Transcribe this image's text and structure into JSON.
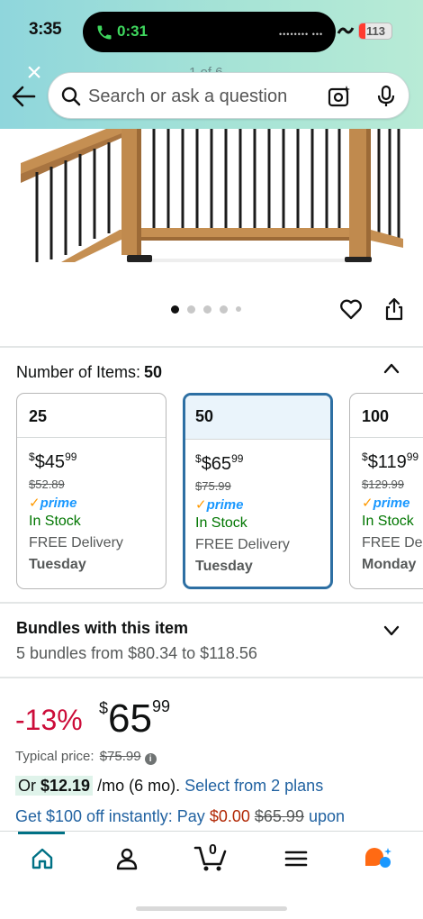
{
  "status_bar": {
    "time": "3:35",
    "call_time": "0:31",
    "battery": "113"
  },
  "header": {
    "page_counter": "1 of 6",
    "search_placeholder": "Search or ask a question"
  },
  "carousel": {
    "dots": 5,
    "active_index": 0
  },
  "items": {
    "label": "Number of Items:",
    "selected_value": "50",
    "options": [
      {
        "qty": "25",
        "price_whole": "$45",
        "price_cents": "99",
        "list_price": "$52.89",
        "prime": "prime",
        "stock": "In Stock",
        "delivery": "FREE Delivery",
        "day": "Tuesday"
      },
      {
        "qty": "50",
        "price_whole": "$65",
        "price_cents": "99",
        "list_price": "$75.99",
        "prime": "prime",
        "stock": "In Stock",
        "delivery": "FREE Delivery",
        "day": "Tuesday"
      },
      {
        "qty": "100",
        "price_whole": "$119",
        "price_cents": "99",
        "list_price": "$129.99",
        "prime": "prime",
        "stock": "In Stock",
        "delivery": "FREE Delivery",
        "day": "Monday"
      }
    ]
  },
  "bundles": {
    "title": "Bundles with this item",
    "subtitle": "5 bundles from $80.34 to $118.56"
  },
  "price": {
    "discount": "-13%",
    "currency": "$",
    "whole": "65",
    "cents": "99",
    "typical_label": "Typical price:",
    "typical_value": "$75.99",
    "monthly_prefix": "Or",
    "monthly_amount": "$12.19",
    "monthly_suffix": "/mo (6 mo).",
    "monthly_link": "Select from 2 plans",
    "promo_text": "Get $100 off instantly: Pay",
    "promo_pay": "$0.00",
    "promo_strike": "$65.99",
    "promo_upon": "upon"
  },
  "bottom_nav": {
    "cart_count": "0",
    "icons": [
      "home-icon",
      "account-icon",
      "cart-icon",
      "menu-icon",
      "rufus-icon"
    ]
  },
  "colors": {
    "accent_teal": "#007185",
    "selected_border": "#2d6fa3",
    "discount_red": "#cc0c39",
    "in_stock_green": "#007600",
    "link_blue": "#2162a1"
  }
}
